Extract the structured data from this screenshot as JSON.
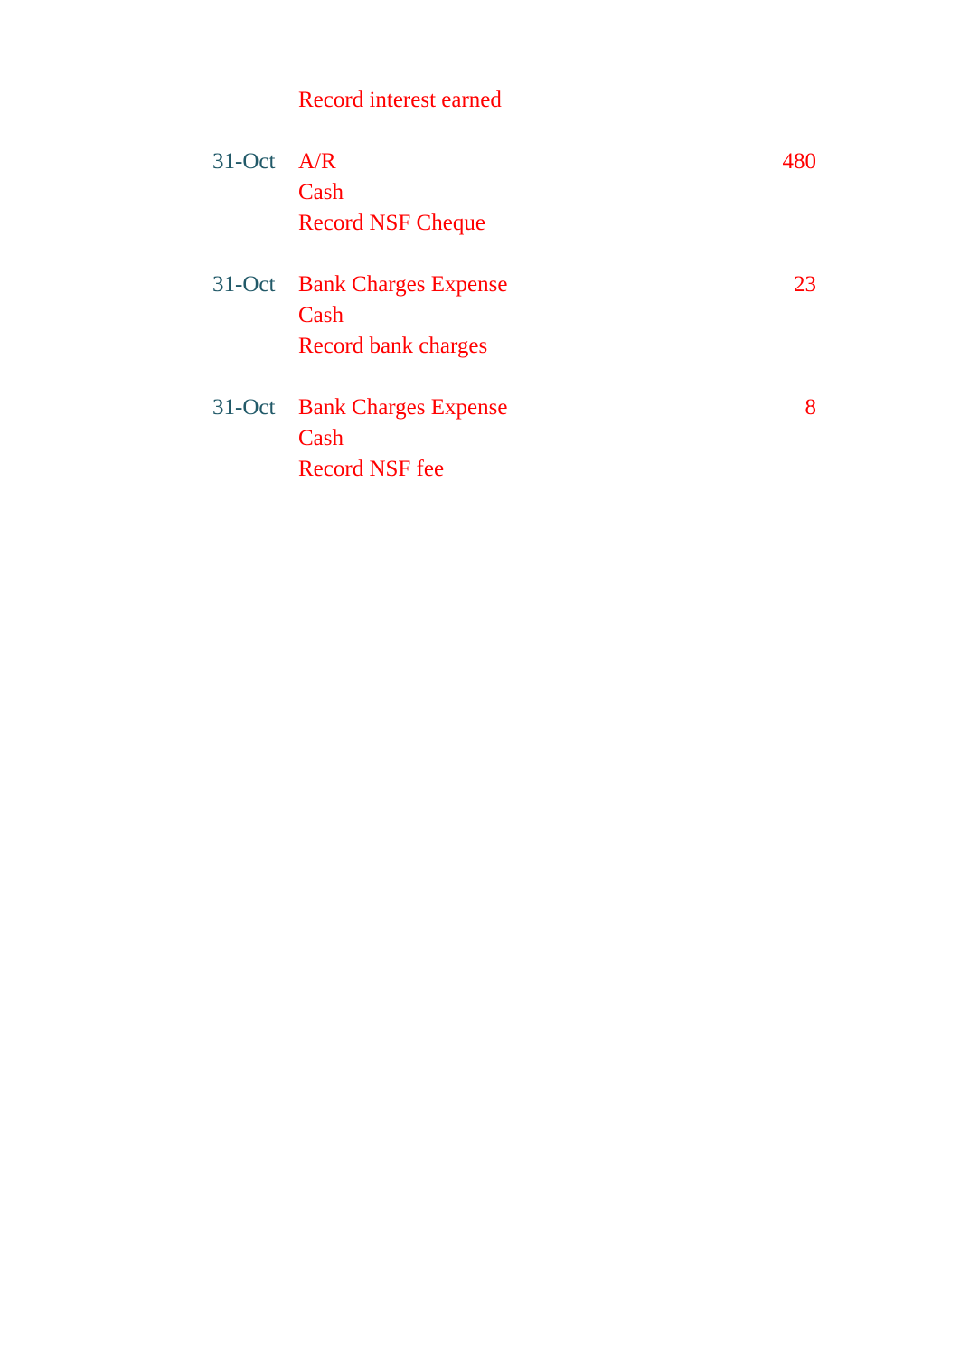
{
  "document": {
    "type": "general-journal",
    "background_color": "#ffffff",
    "date_color": "#215968",
    "entry_color": "#ff0000"
  },
  "journal": {
    "rows": [
      {
        "date": "",
        "account": "Record interest earned",
        "amount": ""
      },
      {
        "date": "",
        "account": "",
        "amount": ""
      },
      {
        "date": "31-Oct",
        "account": "A/R",
        "amount": "480"
      },
      {
        "date": "",
        "account": "Cash",
        "amount": ""
      },
      {
        "date": "",
        "account": "Record NSF Cheque",
        "amount": ""
      },
      {
        "date": "",
        "account": "",
        "amount": ""
      },
      {
        "date": "31-Oct",
        "account": "Bank Charges Expense",
        "amount": "23"
      },
      {
        "date": "",
        "account": "Cash",
        "amount": ""
      },
      {
        "date": "",
        "account": "Record bank charges",
        "amount": ""
      },
      {
        "date": "",
        "account": "",
        "amount": ""
      },
      {
        "date": "31-Oct",
        "account": "Bank Charges Expense",
        "amount": "8"
      },
      {
        "date": "",
        "account": "Cash",
        "amount": ""
      },
      {
        "date": "",
        "account": "Record NSF fee",
        "amount": ""
      }
    ]
  }
}
